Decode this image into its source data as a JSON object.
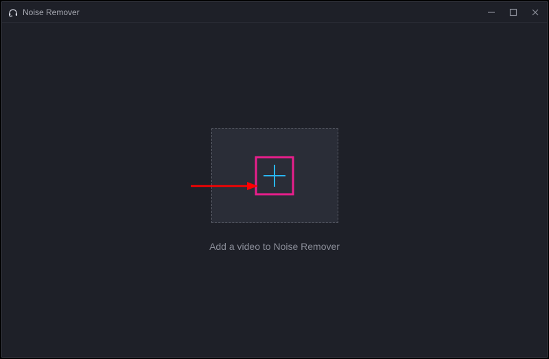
{
  "app": {
    "title": "Noise Remover",
    "icon_name": "headphones-icon"
  },
  "window_controls": {
    "minimize": "minimize",
    "maximize": "maximize",
    "close": "close"
  },
  "main": {
    "instruction": "Add a video to Noise Remover",
    "plus_icon": "plus-icon"
  },
  "colors": {
    "background": "#1e2028",
    "dropzone_bg": "#2a2d37",
    "border_dashed": "#5a5d68",
    "text_muted": "#8a8d98",
    "accent_cyan": "#29b6f6",
    "highlight_magenta": "#e91e8c",
    "arrow_red": "#ff0000"
  }
}
